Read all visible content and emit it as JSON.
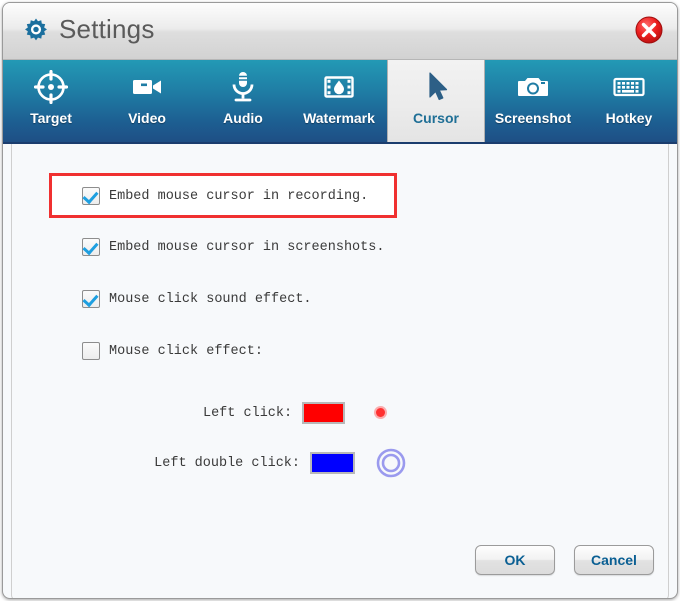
{
  "window": {
    "title": "Settings",
    "title_icon": "gear-icon",
    "close_icon": "close-circle-icon"
  },
  "tabs": [
    {
      "label": "Target",
      "icon": "target-crosshair-icon",
      "active": false
    },
    {
      "label": "Video",
      "icon": "video-camera-icon",
      "active": false
    },
    {
      "label": "Audio",
      "icon": "microphone-icon",
      "active": false
    },
    {
      "label": "Watermark",
      "icon": "film-droplet-icon",
      "active": false
    },
    {
      "label": "Cursor",
      "icon": "mouse-pointer-icon",
      "active": true
    },
    {
      "label": "Screenshot",
      "icon": "camera-icon",
      "active": false
    },
    {
      "label": "Hotkey",
      "icon": "keyboard-icon",
      "active": false
    }
  ],
  "cursor_panel": {
    "options": [
      {
        "label": "Embed mouse cursor in recording.",
        "checked": true,
        "highlighted": true
      },
      {
        "label": "Embed mouse cursor in screenshots.",
        "checked": true,
        "highlighted": false
      },
      {
        "label": "Mouse click sound effect.",
        "checked": true,
        "highlighted": false
      },
      {
        "label": "Mouse click effect:",
        "checked": false,
        "highlighted": false
      }
    ],
    "color_rows": [
      {
        "label": "Left click:",
        "color": "#ff0000",
        "preview": "single-dot-ring"
      },
      {
        "label": "Left double click:",
        "color": "#0000ff",
        "preview": "double-ring"
      }
    ]
  },
  "footer": {
    "ok_label": "OK",
    "cancel_label": "Cancel"
  },
  "colors": {
    "highlight_border": "#f03030",
    "tab_active_text": "#1f6f96",
    "button_text": "#0a5f93",
    "checkbox_check": "#1e9fe0",
    "double_ring": "#9a9aee"
  }
}
